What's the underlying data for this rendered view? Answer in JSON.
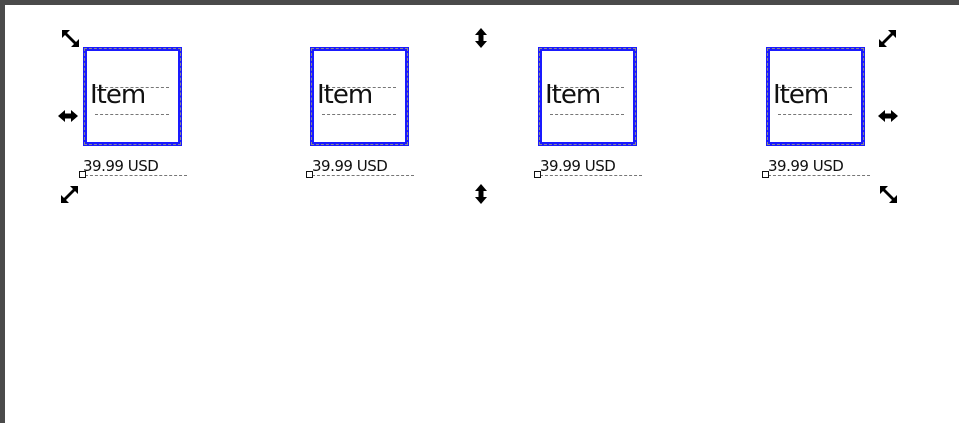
{
  "colors": {
    "frame": "#4a4a4a",
    "selection": "#1a1aff",
    "handle": "#000000"
  },
  "canvas": {
    "items": [
      {
        "label": "Item",
        "price": "39.99 USD"
      },
      {
        "label": "Item",
        "price": "39.99 USD"
      },
      {
        "label": "Item",
        "price": "39.99 USD"
      },
      {
        "label": "Item",
        "price": "39.99 USD"
      }
    ]
  },
  "handles": [
    "scale-nw-arrow-icon",
    "stretch-n-arrow-icon",
    "scale-ne-arrow-icon",
    "stretch-w-arrow-icon",
    "stretch-e-arrow-icon",
    "scale-sw-arrow-icon",
    "stretch-s-arrow-icon",
    "scale-se-arrow-icon"
  ]
}
